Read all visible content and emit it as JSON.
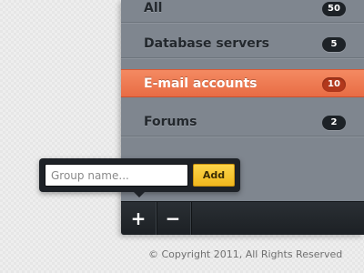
{
  "colors": {
    "panel": "#7f868f",
    "active_item": "#f07a52",
    "toolbar": "#23282d",
    "add_button": "#f6c431",
    "badge": "#1d2227"
  },
  "groups": {
    "items": [
      {
        "label": "All",
        "count": "50",
        "active": false
      },
      {
        "label": "Database servers",
        "count": "5",
        "active": false
      },
      {
        "label": "E-mail accounts",
        "count": "10",
        "active": true
      },
      {
        "label": "Forums",
        "count": "2",
        "active": false
      }
    ]
  },
  "toolbar": {
    "add_icon": "plus-icon",
    "add_glyph": "+",
    "remove_icon": "minus-icon",
    "remove_glyph": "−"
  },
  "popup": {
    "input_value": "",
    "input_placeholder": "Group name...",
    "add_label": "Add"
  },
  "footer": {
    "copyright": "© Copyright 2011, All Rights Reserved"
  }
}
